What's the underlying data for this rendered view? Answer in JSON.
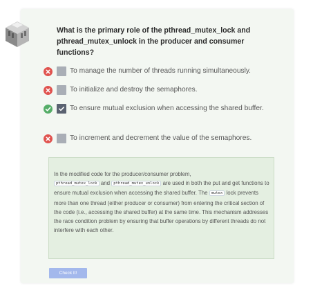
{
  "quiz": {
    "question": "What is the primary role of the pthread_mutex_lock and pthread_mutex_unlock in the producer and consumer functions?",
    "options": [
      {
        "text": "To manage the number of threads running simultaneously.",
        "status": "incorrect",
        "checked": false
      },
      {
        "text": "To initialize and destroy the semaphores.",
        "status": "incorrect",
        "checked": false
      },
      {
        "text": "To ensure mutual exclusion when accessing the shared buffer.",
        "status": "correct",
        "checked": true
      },
      {
        "text": "To increment and decrement the value of the semaphores.",
        "status": "incorrect",
        "checked": false
      }
    ],
    "explanation": {
      "p1": "In the modified code for the producer/consumer problem,",
      "code1": "pthread_mutex_lock",
      "and": "and",
      "code2": "pthread_mutex_unlock",
      "p2": "are used in both the put and get functions to ensure mutual exclusion when accessing the shared buffer. The",
      "code3": "mutex",
      "p3": "lock prevents more than one thread (either producer or consumer) from entering the critical section of the code (i.e., accessing the shared buffer) at the same time. This mechanism addresses the race condition problem by ensuring that buffer operations by different threads do not interfere with each other."
    },
    "check_button": "Check It!"
  },
  "colors": {
    "incorrect": "#e0534f",
    "correct": "#55ad68",
    "checkbox_unchecked": "#a9aeb6",
    "checkbox_checked": "#5a6271",
    "button": "#a3b8ec"
  },
  "icons": {
    "logo": "isometric-cube-logo-icon",
    "incorrect": "x-circle-icon",
    "correct": "check-circle-icon"
  }
}
